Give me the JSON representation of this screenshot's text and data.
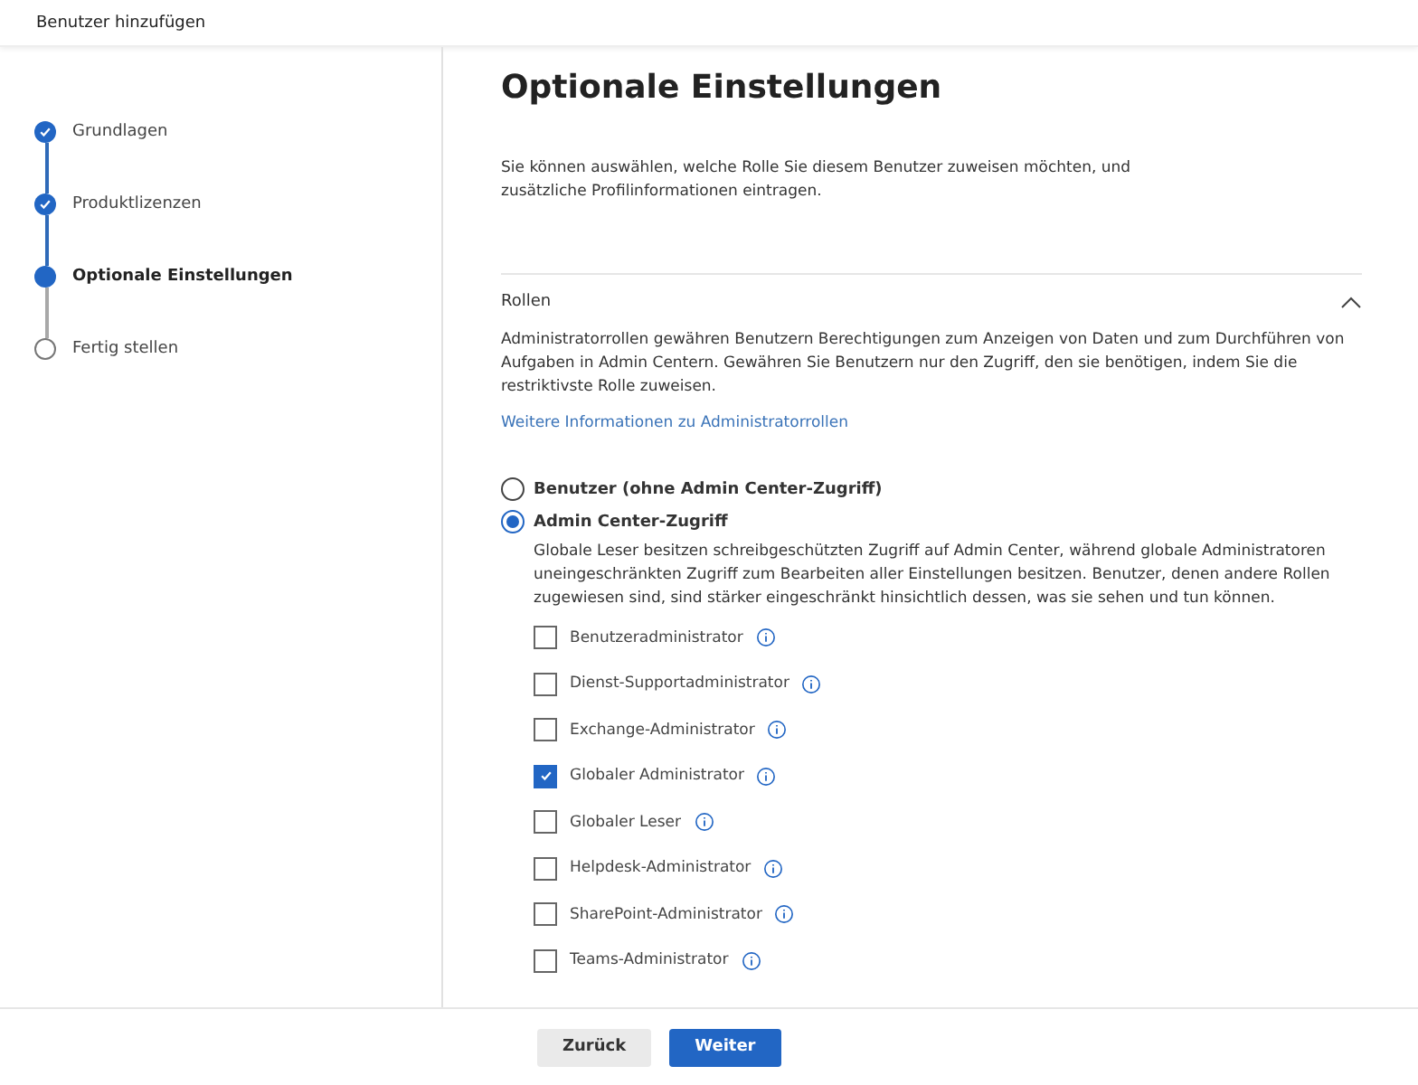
{
  "header": {
    "title": "Benutzer hinzufügen"
  },
  "steps": [
    {
      "label": "Grundlagen",
      "kind": "done"
    },
    {
      "label": "Produktlizenzen",
      "kind": "done"
    },
    {
      "label": "Optionale Einstellungen",
      "kind": "current"
    },
    {
      "label": "Fertig stellen",
      "kind": "todo"
    }
  ],
  "main": {
    "heading": "Optionale Einstellungen",
    "intro": "Sie können auswählen, welche Rolle Sie diesem Benutzer zuweisen möchten, und zusätzliche Profilinformationen eintragen.",
    "section": {
      "title": "Rollen",
      "expanded": true,
      "description": "Administratorrollen gewähren Benutzern Berechtigungen zum Anzeigen von Daten und zum Durchführen von Aufgaben in Admin Centern. Gewähren Sie Benutzern nur den Zugriff, den sie benötigen, indem Sie die restriktivste Rolle zuweisen.",
      "link": "Weitere Informationen zu Administratorrollen",
      "options": [
        {
          "label": "Benutzer (ohne Admin Center-Zugriff)",
          "selected": false
        },
        {
          "label": "Admin Center-Zugriff",
          "selected": true
        }
      ],
      "access_note": "Globale Leser besitzen schreibgeschützten Zugriff auf Admin Center, während globale Administratoren uneingeschränkten Zugriff zum Bearbeiten aller Einstellungen besitzen. Benutzer, denen andere Rollen zugewiesen sind, sind stärker eingeschränkt hinsichtlich dessen, was sie sehen und tun können.",
      "roles": [
        {
          "label": "Benutzeradministrator",
          "checked": false
        },
        {
          "label": "Dienst-Supportadministrator",
          "checked": false
        },
        {
          "label": "Exchange-Administrator",
          "checked": false
        },
        {
          "label": "Globaler Administrator",
          "checked": true
        },
        {
          "label": "Globaler Leser",
          "checked": false
        },
        {
          "label": "Helpdesk-Administrator",
          "checked": false
        },
        {
          "label": "SharePoint-Administrator",
          "checked": false
        },
        {
          "label": "Teams-Administrator",
          "checked": false
        }
      ]
    }
  },
  "footer": {
    "buttons": [
      {
        "label": "Zurück",
        "kind": "secondary"
      },
      {
        "label": "Weiter",
        "kind": "primary"
      }
    ]
  }
}
